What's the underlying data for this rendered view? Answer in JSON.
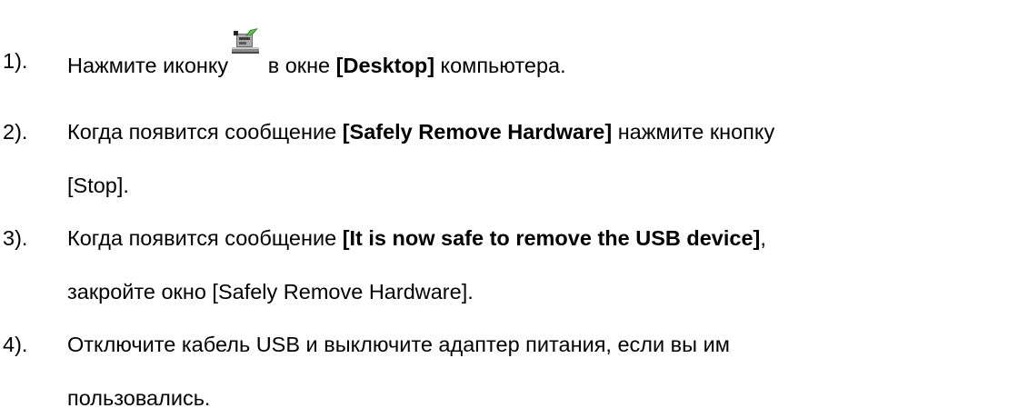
{
  "steps": [
    {
      "number": "1).",
      "lines": [
        {
          "parts": [
            {
              "text": "Нажмите иконку",
              "bold": false
            },
            {
              "icon": "safely-remove-hardware-icon"
            },
            {
              "text": " в окне ",
              "bold": false
            },
            {
              "text": "[Desktop]",
              "bold": true
            },
            {
              "text": " компьютера.",
              "bold": false
            }
          ]
        }
      ]
    },
    {
      "number": "2).",
      "lines": [
        {
          "parts": [
            {
              "text": "Когда появится сообщение ",
              "bold": false
            },
            {
              "text": "[Safely Remove Hardware]",
              "bold": true
            },
            {
              "text": " нажмите кнопку",
              "bold": false
            }
          ]
        },
        {
          "parts": [
            {
              "text": "[Stop].",
              "bold": false
            }
          ]
        }
      ]
    },
    {
      "number": "3).",
      "lines": [
        {
          "parts": [
            {
              "text": "Когда появится сообщение ",
              "bold": false
            },
            {
              "text": "[It is now safe to remove the USB device]",
              "bold": true
            },
            {
              "text": ",",
              "bold": false
            }
          ]
        },
        {
          "parts": [
            {
              "text": "закройте окно [Safely Remove Hardware].",
              "bold": false
            }
          ]
        }
      ]
    },
    {
      "number": "4).",
      "lines": [
        {
          "parts": [
            {
              "text": "Отключите кабель USB и выключите адаптер питания, если вы им",
              "bold": false
            }
          ]
        },
        {
          "parts": [
            {
              "text": "пользовались.",
              "bold": false
            }
          ]
        }
      ]
    }
  ]
}
